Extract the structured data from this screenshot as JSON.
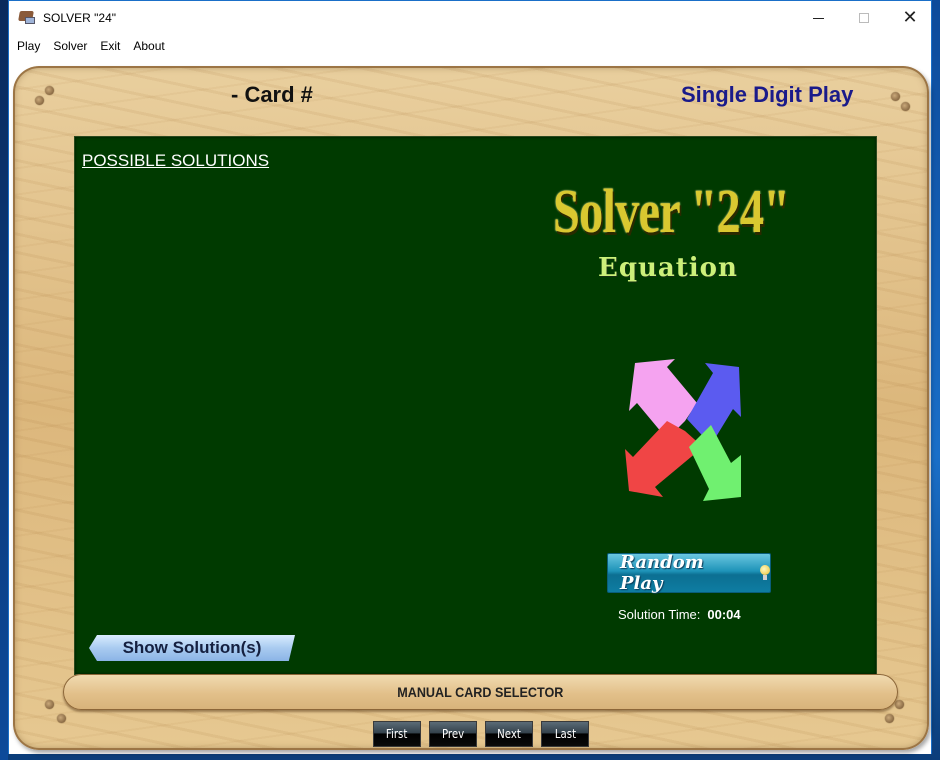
{
  "window": {
    "title": "SOLVER \"24\"",
    "controls": {
      "minimize": "minimize",
      "maximize": "maximize",
      "close": "close"
    }
  },
  "menu": [
    "Play",
    "Solver",
    "Exit",
    "About"
  ],
  "header": {
    "card_label": "- Card #",
    "mode_label": "Single Digit Play"
  },
  "board": {
    "solutions_heading": "POSSIBLE SOLUTIONS",
    "logo_title": "Solver \"24\"",
    "logo_subtitle": "Equation",
    "arrows": [
      {
        "direction": "up-left",
        "color": "#f5a3f0"
      },
      {
        "direction": "up-right",
        "color": "#5b5bf0"
      },
      {
        "direction": "down-left",
        "color": "#f04545"
      },
      {
        "direction": "down-right",
        "color": "#70f070"
      }
    ],
    "random_play_label": "Random Play",
    "solution_time_label": "Solution Time:",
    "solution_time_value": "00:04",
    "show_solutions_label": "Show Solution(s)"
  },
  "selector": {
    "label": "MANUAL CARD SELECTOR",
    "buttons": [
      "First",
      "Prev",
      "Next",
      "Last"
    ]
  },
  "colors": {
    "board": "#003a00",
    "mode_label": "#1a1a8a",
    "logo": "#d9c830",
    "logo_subtitle": "#ccf07a"
  }
}
